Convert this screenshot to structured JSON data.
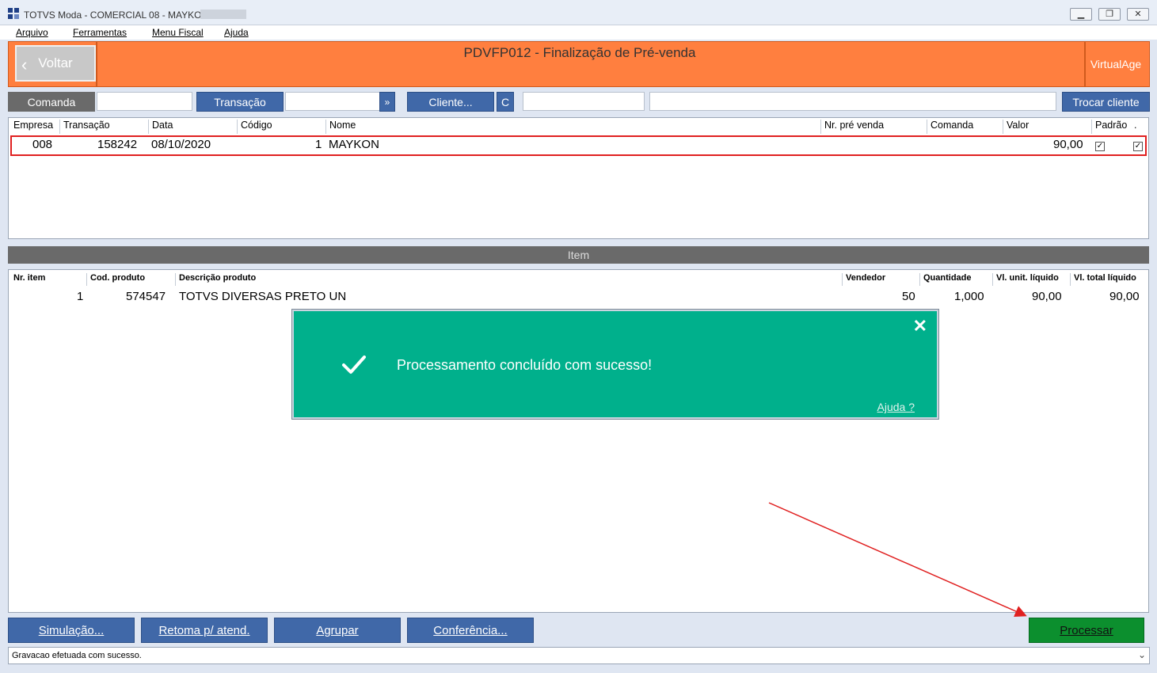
{
  "window": {
    "title": "TOTVS Moda - COMERCIAL 08 - MAYKON",
    "controls": {
      "minimize": "▁",
      "maximize": "❐",
      "close": "✕"
    }
  },
  "menu": {
    "items": [
      "Arquivo",
      "Ferramentas",
      "Menu Fiscal",
      "Ajuda"
    ]
  },
  "header": {
    "back_label": "Voltar",
    "title": "PDVFP012 - Finalização de Pré-venda",
    "brand": "VirtualAge"
  },
  "filters": {
    "comanda_label": "Comanda",
    "transacao_label": "Transação",
    "arrow_label": "»",
    "cliente_label": "Cliente...",
    "c_label": "C",
    "trocar_label": "Trocar cliente"
  },
  "transactions": {
    "columns": [
      "Empresa",
      "Transação",
      "Data",
      "Código",
      "Nome",
      "Nr. pré venda",
      "Comanda",
      "Valor",
      "Padrão",
      "."
    ],
    "rows": [
      {
        "empresa": "008",
        "transacao": "158242",
        "data": "08/10/2020",
        "codigo": "1",
        "nome": "MAYKON",
        "nr_pre_venda": "",
        "comanda": "",
        "valor": "90,00",
        "padrao": true,
        "check2": true
      }
    ]
  },
  "item_section": {
    "title": "Item"
  },
  "items": {
    "columns": [
      "Nr. item",
      "Cod. produto",
      "Descrição produto",
      "Vendedor",
      "Quantidade",
      "Vl. unit. líquido",
      "Vl. total líquido"
    ],
    "rows": [
      {
        "nr": "1",
        "cod": "574547",
        "descricao": "TOTVS DIVERSAS PRETO UN",
        "vendedor": "50",
        "quantidade": "1,000",
        "unit": "90,00",
        "total": "90,00"
      }
    ]
  },
  "toast": {
    "message": "Processamento concluído com sucesso!",
    "help": "Ajuda ?",
    "close": "✕",
    "color": "#00b08c"
  },
  "actions": {
    "simulacao": "Simulação...",
    "retoma": "Retoma p/ atend.",
    "agrupar": "Agrupar",
    "conferencia": "Conferência...",
    "processar": "Processar"
  },
  "status": {
    "text": "Gravacao efetuada com sucesso.",
    "dropdown": "⌄"
  },
  "colors": {
    "accent": "#ff7f3f",
    "button_blue": "#4068a8",
    "process_green": "#0c8f2e"
  }
}
